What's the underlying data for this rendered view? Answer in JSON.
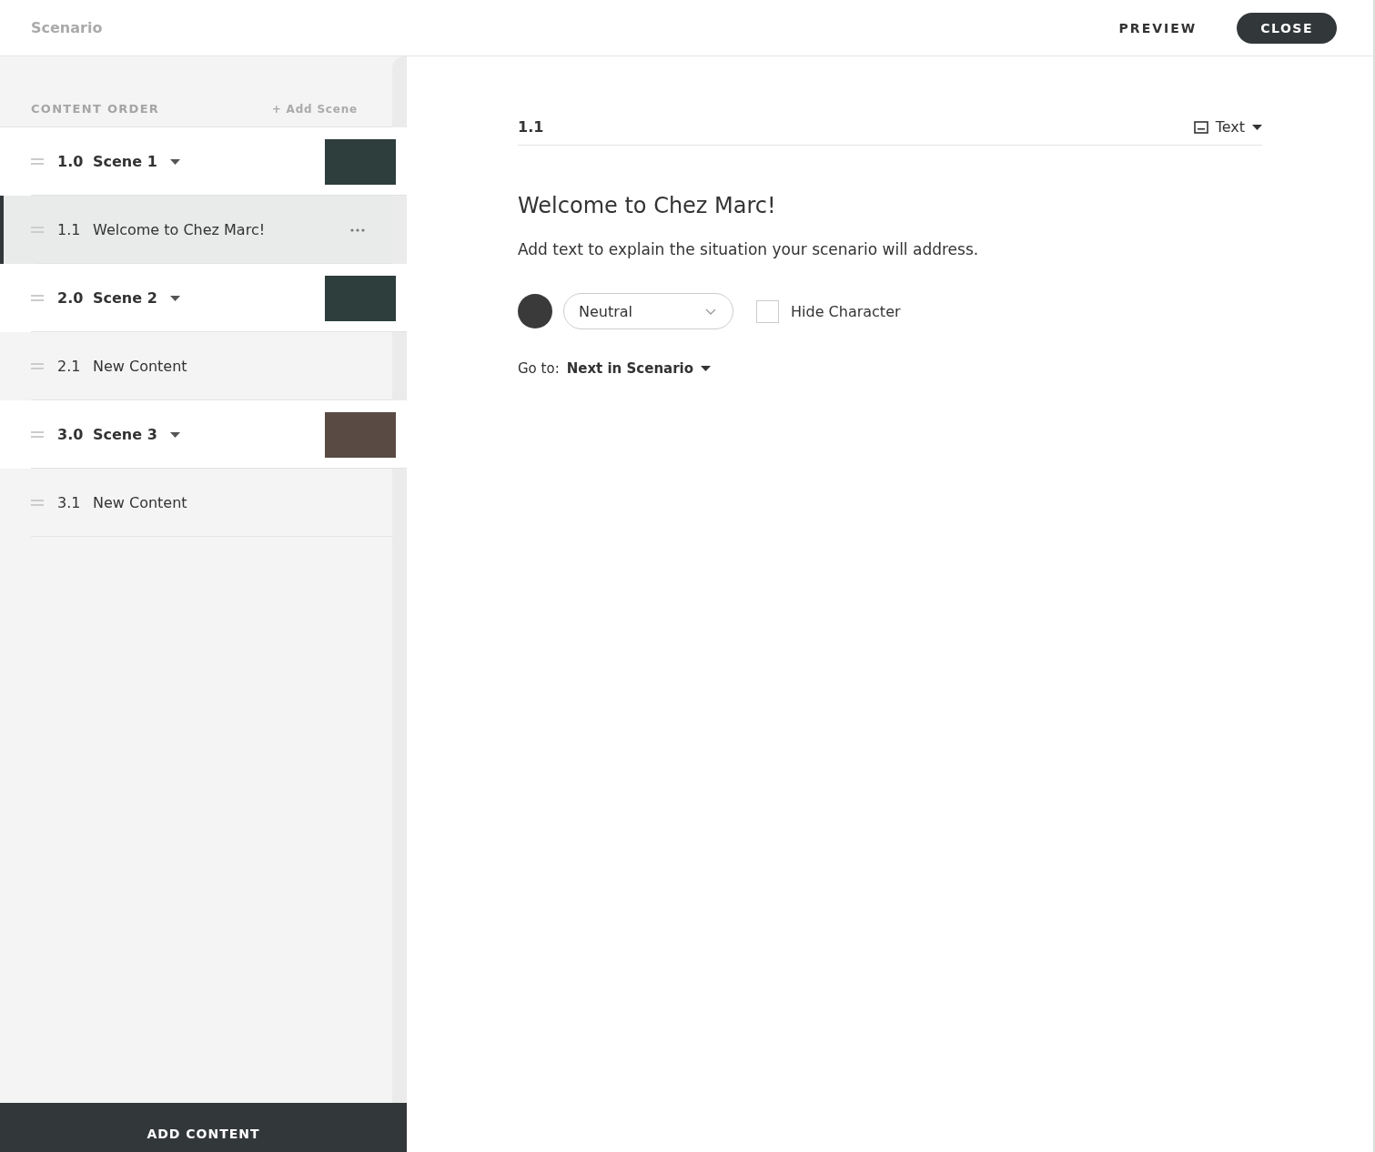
{
  "header": {
    "title": "Scenario",
    "preview": "PREVIEW",
    "close": "CLOSE"
  },
  "sidebar": {
    "heading": "CONTENT ORDER",
    "add_scene": "+ Add Scene",
    "add_content": "ADD CONTENT",
    "items": [
      {
        "kind": "scene",
        "number": "1.0",
        "title": "Scene 1",
        "selected": false
      },
      {
        "kind": "content",
        "number": "1.1",
        "title": "Welcome to Chez Marc!",
        "selected": true
      },
      {
        "kind": "scene",
        "number": "2.0",
        "title": "Scene 2",
        "selected": false
      },
      {
        "kind": "content",
        "number": "2.1",
        "title": "New Content",
        "selected": false
      },
      {
        "kind": "scene",
        "number": "3.0",
        "title": "Scene 3",
        "selected": false
      },
      {
        "kind": "content",
        "number": "3.1",
        "title": "New Content",
        "selected": false
      }
    ]
  },
  "editor": {
    "number": "1.1",
    "type": "Text",
    "heading": "Welcome to Chez Marc!",
    "body": "Add text to explain the situation your scenario will address.",
    "mood": "Neutral",
    "hide_character": {
      "label": "Hide Character",
      "checked": false
    },
    "goto_label": "Go to:",
    "goto_value": "Next in Scenario"
  }
}
